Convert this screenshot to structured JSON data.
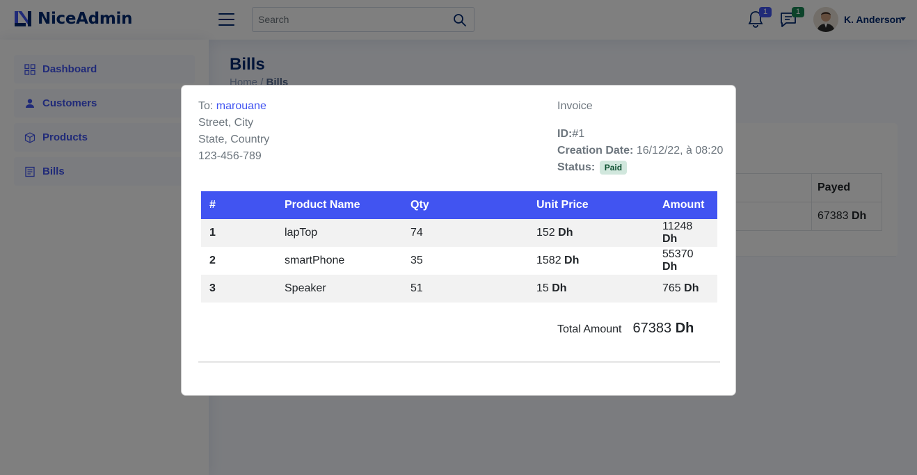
{
  "app": {
    "logo_text": "NiceAdmin"
  },
  "search": {
    "placeholder": "Search"
  },
  "notifications": {
    "bell_count": "1",
    "messages_count": "1"
  },
  "profile": {
    "name": "K. Anderson"
  },
  "sidebar": {
    "items": [
      {
        "label": "Dashboard",
        "icon": "grid-icon"
      },
      {
        "label": "Customers",
        "icon": "person-icon"
      },
      {
        "label": "Products",
        "icon": "box-icon"
      },
      {
        "label": "Bills",
        "icon": "receipt-icon"
      }
    ]
  },
  "page": {
    "title": "Bills",
    "breadcrumb": [
      "Home",
      "Bills"
    ],
    "table": {
      "header_payed": "Payed",
      "payed_value": "67383",
      "payed_unit": "Dh"
    }
  },
  "invoice": {
    "to_label": "To:",
    "customer": "marouane",
    "address_line1": "Street, City",
    "address_line2": "State, Country",
    "phone": "123-456-789",
    "title": "Invoice",
    "id_label": "ID:",
    "id_value": "#1",
    "creation_label": "Creation Date:",
    "creation_value": "16/12/22, à 08:20",
    "status_label": "Status:",
    "status_value": "Paid",
    "columns": [
      "#",
      "Product Name",
      "Qty",
      "Unit Price",
      "Amount"
    ],
    "rows": [
      {
        "num": "1",
        "name": "lapTop",
        "qty": "74",
        "price": "152",
        "amount": "11248"
      },
      {
        "num": "2",
        "name": "smartPhone",
        "qty": "35",
        "price": "1582",
        "amount": "55370"
      },
      {
        "num": "3",
        "name": "Speaker",
        "qty": "51",
        "price": "15",
        "amount": "765"
      }
    ],
    "currency": "Dh",
    "total_label": "Total Amount",
    "total_value": "67383"
  },
  "colors": {
    "brand": "#4154f1",
    "navy": "#012970",
    "success_bg": "#d1e7dd"
  }
}
